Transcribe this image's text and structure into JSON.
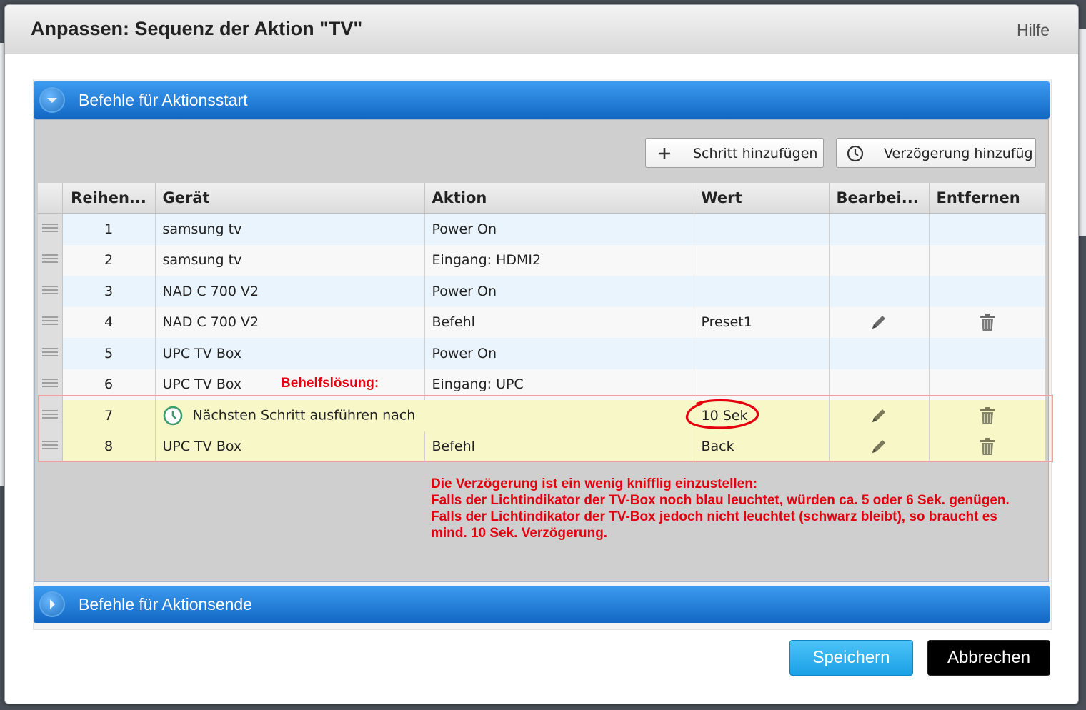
{
  "dialog": {
    "title": "Anpassen: Sequenz der Aktion \"TV\"",
    "help_label": "Hilfe"
  },
  "section_start": {
    "label": "Befehle für Aktionsstart",
    "icon": "chevron-down-icon"
  },
  "section_end": {
    "label": "Befehle für Aktionsende",
    "icon": "chevron-right-icon"
  },
  "toolbar": {
    "add_step_label": "Schritt hinzufügen",
    "add_step_icon": "plus-icon",
    "add_delay_label": "Verzögerung hinzufüg",
    "add_delay_icon": "clock-icon"
  },
  "table": {
    "columns": [
      "Reihen...",
      "Gerät",
      "Aktion",
      "Wert",
      "Bearbei...",
      "Entfernen"
    ],
    "rows": [
      {
        "order": "1",
        "device": "samsung tv",
        "action": "Power On",
        "value": "",
        "editable": false,
        "removable": false
      },
      {
        "order": "2",
        "device": "samsung tv",
        "action": "Eingang: HDMI2",
        "value": "",
        "editable": false,
        "removable": false
      },
      {
        "order": "3",
        "device": "NAD C 700 V2",
        "action": "Power On",
        "value": "",
        "editable": false,
        "removable": false
      },
      {
        "order": "4",
        "device": "NAD C 700 V2",
        "action": "Befehl",
        "value": "Preset1",
        "editable": true,
        "removable": true
      },
      {
        "order": "5",
        "device": "UPC TV Box",
        "action": "Power On",
        "value": "",
        "editable": false,
        "removable": false
      },
      {
        "order": "6",
        "device": "UPC TV Box",
        "action": "Eingang: UPC",
        "value": "",
        "editable": false,
        "removable": false
      },
      {
        "order": "7",
        "device": "Nächsten Schritt ausführen nach",
        "device_icon": "clock-icon",
        "action": "",
        "value": "10 Sek",
        "editable": true,
        "removable": true,
        "highlighted": true
      },
      {
        "order": "8",
        "device": "UPC TV Box",
        "action": "Befehl",
        "value": "Back",
        "editable": true,
        "removable": true,
        "highlighted": true
      }
    ]
  },
  "annotations": {
    "workaround_label": "Behelfslösung:",
    "note_lines": [
      "Die Verzögerung ist ein wenig knifflig einzustellen:",
      "Falls der Lichtindikator der TV-Box noch blau leuchtet, würden ca. 5 oder 6 Sek. genügen.",
      "Falls der Lichtindikator der TV-Box jedoch nicht leuchtet (schwarz bleibt), so braucht es",
      "mind. 10 Sek. Verzögerung."
    ],
    "color": "#e4000f"
  },
  "footer": {
    "save_label": "Speichern",
    "cancel_label": "Abbrechen"
  },
  "colors": {
    "accordion": "#1e7fd9",
    "save_button": "#29aef0",
    "highlight_row": "#f7f7c8"
  }
}
